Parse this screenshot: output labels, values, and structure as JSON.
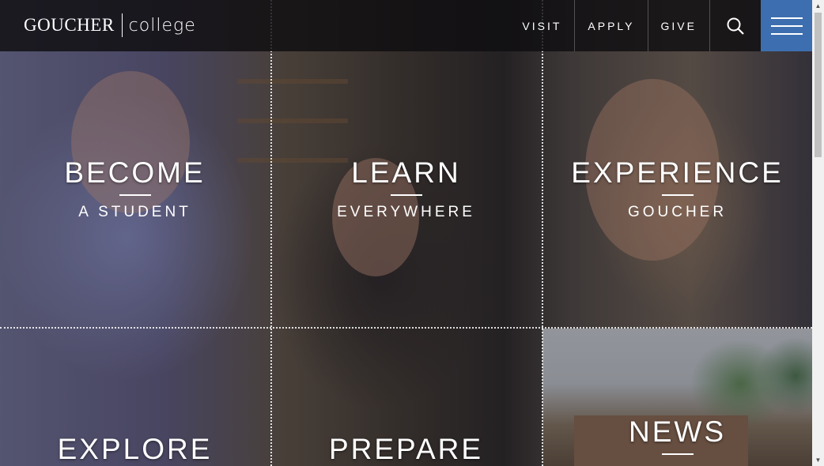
{
  "header": {
    "logo_main": "GOUCHER",
    "logo_sub": "college",
    "nav": [
      "VISIT",
      "APPLY",
      "GIVE"
    ],
    "accent_color": "#3d6fb0"
  },
  "tiles": [
    {
      "title": "BECOME",
      "subtitle": "A STUDENT"
    },
    {
      "title": "LEARN",
      "subtitle": "EVERYWHERE"
    },
    {
      "title": "EXPERIENCE",
      "subtitle": "GOUCHER"
    },
    {
      "title": "EXPLORE"
    },
    {
      "title": "PREPARE"
    },
    {
      "title": "NEWS"
    }
  ],
  "icons": {
    "search": "search-icon",
    "menu": "hamburger-menu-icon"
  }
}
